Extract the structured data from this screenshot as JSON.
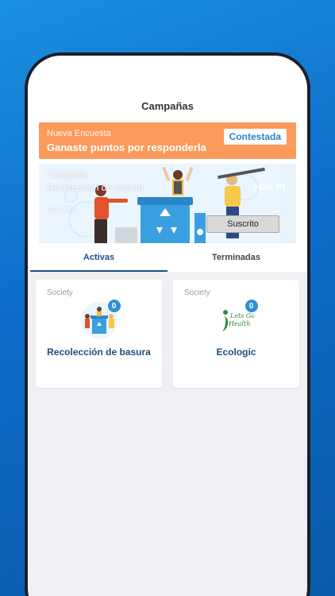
{
  "header": {
    "title": "Campañas"
  },
  "survey": {
    "small_label": "Nueva Encuesta",
    "big_label": "Ganaste puntos por responderla",
    "button_label": "Contestada"
  },
  "banner": {
    "title_line1": "Campaña",
    "title_line2": "Recolección de basura",
    "society": "Society",
    "points": "+150 PT",
    "button_label": "Suscrito"
  },
  "tabs": [
    {
      "label": "Activas",
      "active": true
    },
    {
      "label": "Terminadas",
      "active": false
    }
  ],
  "cards": [
    {
      "society": "Society",
      "badge": "0",
      "title": "Recolección de basura",
      "logo": "recycling-illustration-icon"
    },
    {
      "society": "Society",
      "badge": "0",
      "title": "Ecologic",
      "logo": "lets-go-healthy-logo",
      "logo_text_line1": "Lets Go",
      "logo_text_line2": "Health"
    }
  ],
  "colors": {
    "survey_orange": "#fb9a5a",
    "accent_blue": "#1d4f88",
    "badge_blue": "#2d8fd6"
  }
}
